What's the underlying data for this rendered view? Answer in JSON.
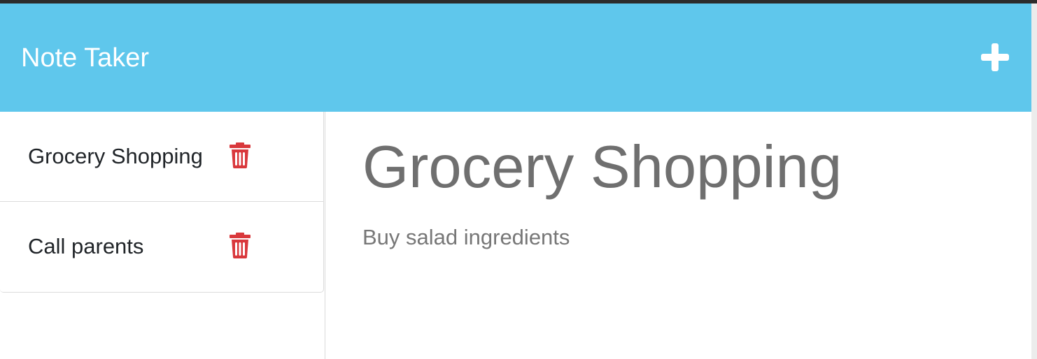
{
  "navbar": {
    "brand": "Note Taker",
    "background_color": "#5fc7ec",
    "add_icon": "plus-icon"
  },
  "notes": [
    {
      "title": "Grocery Shopping",
      "delete_icon": "trash-icon"
    },
    {
      "title": "Call parents",
      "delete_icon": "trash-icon"
    }
  ],
  "colors": {
    "delete": "#d9383c",
    "title_text": "#6f6f6f",
    "body_text": "#777777"
  },
  "active_note": {
    "title": "Grocery Shopping",
    "text": "Buy salad ingredients"
  }
}
